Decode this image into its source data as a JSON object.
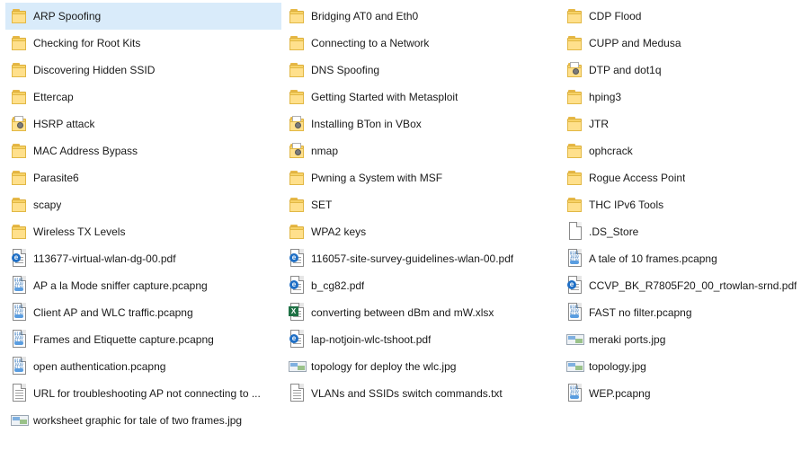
{
  "selected_index": 0,
  "files": [
    {
      "name": "ARP Spoofing",
      "type": "folder"
    },
    {
      "name": "Bridging AT0 and Eth0",
      "type": "folder"
    },
    {
      "name": "CDP Flood",
      "type": "folder"
    },
    {
      "name": "Checking for Root Kits",
      "type": "folder"
    },
    {
      "name": "Connecting to a Network",
      "type": "folder"
    },
    {
      "name": "CUPP and Medusa",
      "type": "folder"
    },
    {
      "name": "Discovering Hidden SSID",
      "type": "folder"
    },
    {
      "name": "DNS Spoofing",
      "type": "folder"
    },
    {
      "name": "DTP and dot1q",
      "type": "folder-content"
    },
    {
      "name": "Ettercap",
      "type": "folder"
    },
    {
      "name": "Getting Started with Metasploit",
      "type": "folder"
    },
    {
      "name": "hping3",
      "type": "folder"
    },
    {
      "name": "HSRP attack",
      "type": "folder-content"
    },
    {
      "name": "Installing BTon in VBox",
      "type": "folder-content"
    },
    {
      "name": "JTR",
      "type": "folder"
    },
    {
      "name": "MAC Address Bypass",
      "type": "folder"
    },
    {
      "name": "nmap",
      "type": "folder-content"
    },
    {
      "name": "ophcrack",
      "type": "folder"
    },
    {
      "name": "Parasite6",
      "type": "folder"
    },
    {
      "name": "Pwning a System with MSF",
      "type": "folder"
    },
    {
      "name": "Rogue Access Point",
      "type": "folder"
    },
    {
      "name": "scapy",
      "type": "folder"
    },
    {
      "name": "SET",
      "type": "folder"
    },
    {
      "name": "THC IPv6 Tools",
      "type": "folder"
    },
    {
      "name": "Wireless TX Levels",
      "type": "folder"
    },
    {
      "name": "WPA2 keys",
      "type": "folder"
    },
    {
      "name": ".DS_Store",
      "type": "blank"
    },
    {
      "name": "113677-virtual-wlan-dg-00.pdf",
      "type": "pdf"
    },
    {
      "name": "116057-site-survey-guidelines-wlan-00.pdf",
      "type": "pdf"
    },
    {
      "name": "A tale of 10 frames.pcapng",
      "type": "pcap"
    },
    {
      "name": "AP a la Mode sniffer capture.pcapng",
      "type": "pcap"
    },
    {
      "name": "b_cg82.pdf",
      "type": "pdf"
    },
    {
      "name": "CCVP_BK_R7805F20_00_rtowlan-srnd.pdf",
      "type": "pdf"
    },
    {
      "name": "Client AP and WLC traffic.pcapng",
      "type": "pcap"
    },
    {
      "name": "converting between dBm and mW.xlsx",
      "type": "xlsx"
    },
    {
      "name": "FAST no filter.pcapng",
      "type": "pcap"
    },
    {
      "name": "Frames and Etiquette capture.pcapng",
      "type": "pcap"
    },
    {
      "name": "lap-notjoin-wlc-tshoot.pdf",
      "type": "pdf"
    },
    {
      "name": "meraki ports.jpg",
      "type": "image"
    },
    {
      "name": "open authentication.pcapng",
      "type": "pcap"
    },
    {
      "name": "topology for deploy the wlc.jpg",
      "type": "image"
    },
    {
      "name": "topology.jpg",
      "type": "image"
    },
    {
      "name": "URL for troubleshooting AP not connecting to ...",
      "type": "text"
    },
    {
      "name": "VLANs and SSIDs switch commands.txt",
      "type": "text"
    },
    {
      "name": "WEP.pcapng",
      "type": "pcap"
    },
    {
      "name": "worksheet graphic for tale of two frames.jpg",
      "type": "image"
    }
  ]
}
